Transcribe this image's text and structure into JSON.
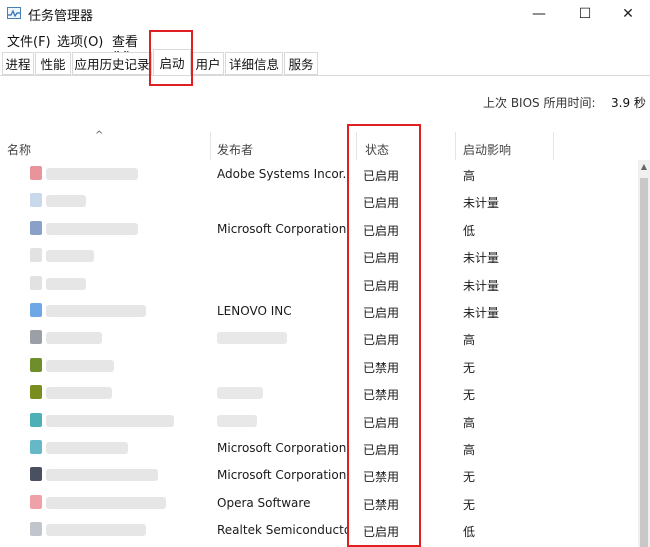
{
  "window": {
    "title": "任务管理器",
    "minimize": "—",
    "maximize": "☐",
    "close": "✕"
  },
  "menu": [
    "文件(F)",
    "选项(O)",
    "查看(V)"
  ],
  "tabs": [
    "进程",
    "性能",
    "应用历史记录",
    "启动",
    "用户",
    "详细信息",
    "服务"
  ],
  "active_tab": "启动",
  "bios": {
    "label": "上次 BIOS 所用时间:",
    "value": "3.9 秒"
  },
  "columns": {
    "name": "名称",
    "publisher": "发布者",
    "status": "状态",
    "impact": "启动影响"
  },
  "sort_arrow": "^",
  "rows": [
    {
      "publisher": "Adobe Systems Incor...",
      "status": "已启用",
      "impact": "高",
      "icon_color": "#e8949a"
    },
    {
      "publisher": "",
      "status": "已启用",
      "impact": "未计量",
      "icon_color": "#c9d9ec"
    },
    {
      "publisher": "Microsoft Corporation",
      "status": "已启用",
      "impact": "低",
      "icon_color": "#8aa0c8"
    },
    {
      "publisher": "",
      "status": "已启用",
      "impact": "未计量",
      "icon_color": "#e2e2e2"
    },
    {
      "publisher": "",
      "status": "已启用",
      "impact": "未计量",
      "icon_color": "#e2e2e2"
    },
    {
      "publisher": "LENOVO INC",
      "status": "已启用",
      "impact": "未计量",
      "icon_color": "#6ea6e6"
    },
    {
      "publisher": "",
      "status": "已启用",
      "impact": "高",
      "icon_color": "#9aa0a6"
    },
    {
      "publisher": "",
      "status": "已禁用",
      "impact": "无",
      "icon_color": "#6e8e2c"
    },
    {
      "publisher": "",
      "status": "已禁用",
      "impact": "无",
      "icon_color": "#7a8e20"
    },
    {
      "publisher": "",
      "status": "已启用",
      "impact": "高",
      "icon_color": "#4cb0b6"
    },
    {
      "publisher": "Microsoft Corporation",
      "status": "已启用",
      "impact": "高",
      "icon_color": "#66b8c8"
    },
    {
      "publisher": "Microsoft Corporation",
      "status": "已禁用",
      "impact": "无",
      "icon_color": "#4a5060"
    },
    {
      "publisher": "Opera Software",
      "status": "已禁用",
      "impact": "无",
      "icon_color": "#f0a0a8"
    },
    {
      "publisher": "Realtek Semiconductor",
      "status": "已启用",
      "impact": "低",
      "icon_color": "#c0c6cc"
    }
  ],
  "highlight_color": "#e02020"
}
